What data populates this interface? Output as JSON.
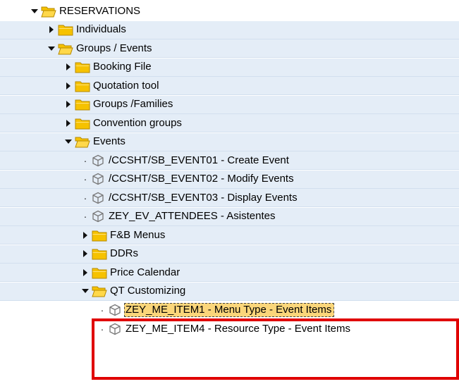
{
  "tree": {
    "nodes": [
      {
        "label": "RESERVATIONS",
        "type": "folder",
        "state": "expanded",
        "level": 0,
        "band": false
      },
      {
        "label": "Individuals",
        "type": "folder",
        "state": "collapsed",
        "level": 1,
        "band": true
      },
      {
        "label": "Groups / Events",
        "type": "folder",
        "state": "expanded",
        "level": 1,
        "band": true
      },
      {
        "label": "Booking File",
        "type": "folder",
        "state": "collapsed",
        "level": 2,
        "band": true
      },
      {
        "label": "Quotation tool",
        "type": "folder",
        "state": "collapsed",
        "level": 2,
        "band": true
      },
      {
        "label": "Groups /Families",
        "type": "folder",
        "state": "collapsed",
        "level": 2,
        "band": true
      },
      {
        "label": "Convention groups",
        "type": "folder",
        "state": "collapsed",
        "level": 2,
        "band": true
      },
      {
        "label": "Events",
        "type": "folder",
        "state": "expanded",
        "level": 2,
        "band": true
      },
      {
        "label": "/CCSHT/SB_EVENT01 - Create Event",
        "type": "transaction",
        "level": 3,
        "band": true
      },
      {
        "label": "/CCSHT/SB_EVENT02 - Modify Events",
        "type": "transaction",
        "level": 3,
        "band": true
      },
      {
        "label": "/CCSHT/SB_EVENT03 - Display Events",
        "type": "transaction",
        "level": 3,
        "band": true
      },
      {
        "label": "ZEY_EV_ATTENDEES - Asistentes",
        "type": "transaction",
        "level": 3,
        "band": true
      },
      {
        "label": "F&B Menus",
        "type": "folder",
        "state": "collapsed",
        "level": 3,
        "band": true
      },
      {
        "label": "DDRs",
        "type": "folder",
        "state": "collapsed",
        "level": 3,
        "band": true
      },
      {
        "label": "Price Calendar",
        "type": "folder",
        "state": "collapsed",
        "level": 3,
        "band": true
      },
      {
        "label": "QT Customizing",
        "type": "folder",
        "state": "expanded",
        "level": 3,
        "band": true
      },
      {
        "label": "ZEY_ME_ITEM1 - Menu Type - Event Items",
        "type": "transaction",
        "level": 4,
        "band": false,
        "selected": true
      },
      {
        "label": "ZEY_ME_ITEM4 - Resource Type - Event Items",
        "type": "transaction",
        "level": 4,
        "band": false
      }
    ]
  },
  "colors": {
    "folder_fill": "#f6c200",
    "folder_open_fill": "#ffd84a",
    "folder_outline": "#b58900",
    "band_background": "#e4edf7",
    "selection_background": "#fbd67a",
    "highlight_border": "#e00000"
  },
  "icons": {
    "folder": "folder-icon",
    "folder_open": "folder-open-icon",
    "transaction": "transaction-cube-icon",
    "expanded": "triangle-down-icon",
    "collapsed": "triangle-right-icon",
    "leaf": "bullet-dot-icon"
  }
}
